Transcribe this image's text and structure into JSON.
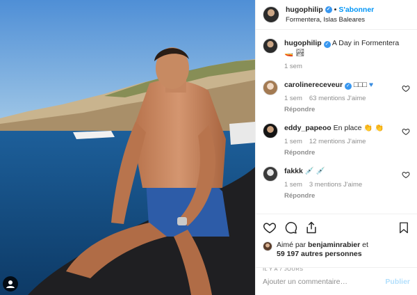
{
  "header": {
    "username": "hugophilip",
    "follow_label": "S'abonner",
    "separator": "•",
    "location": "Formentera, Islas Baleares"
  },
  "caption": {
    "username": "hugophilip",
    "text": "A Day in Formentera",
    "time": "1 sem"
  },
  "comments": [
    {
      "username": "carolinereceveur",
      "text": "",
      "time": "1 sem",
      "likes": "63 mentions J'aime",
      "reply": "Répondre"
    },
    {
      "username": "eddy_papeoo",
      "text": "En place",
      "time": "1 sem",
      "likes": "12 mentions J'aime",
      "reply": "Répondre"
    },
    {
      "username": "fakkk",
      "text": "",
      "time": "1 sem",
      "likes": "3 mentions J'aime",
      "reply": "Répondre"
    }
  ],
  "likes": {
    "prefix": "Aimé par",
    "user": "benjaminrabier",
    "conj": "et",
    "others": "59 197 autres personnes"
  },
  "timestamp": "IL Y A 7 JOURS",
  "add_comment": {
    "placeholder": "Ajouter un commentaire…",
    "publish": "Publier"
  },
  "icons": [
    "heart-icon",
    "comment-icon",
    "share-icon",
    "bookmark-icon",
    "user-tag-icon"
  ],
  "colors": {
    "accent": "#0095f6",
    "muted": "#8e8e8e",
    "verified": "#3897f0",
    "publish_disabled": "#b2dffc"
  }
}
